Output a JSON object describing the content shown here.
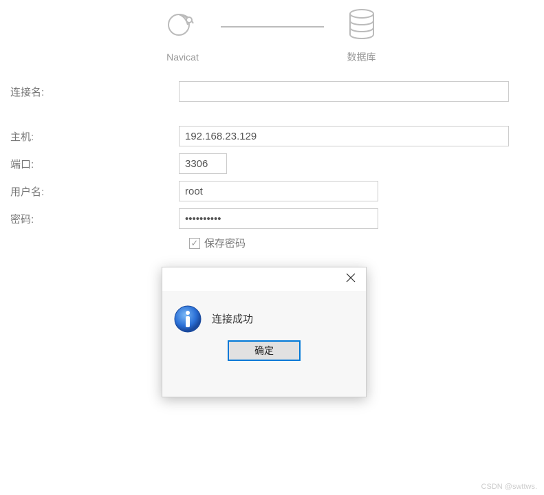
{
  "header": {
    "navicat_label": "Navicat",
    "database_label": "数据库"
  },
  "form": {
    "connection_name_label": "连接名:",
    "connection_name_value": "",
    "host_label": "主机:",
    "host_value": "192.168.23.129",
    "port_label": "端口:",
    "port_value": "3306",
    "username_label": "用户名:",
    "username_value": "root",
    "password_label": "密码:",
    "password_value": "••••••••••",
    "save_password_label": "保存密码",
    "save_password_checked": true
  },
  "dialog": {
    "message": "连接成功",
    "ok_label": "确定"
  },
  "watermark": "CSDN @swttws."
}
